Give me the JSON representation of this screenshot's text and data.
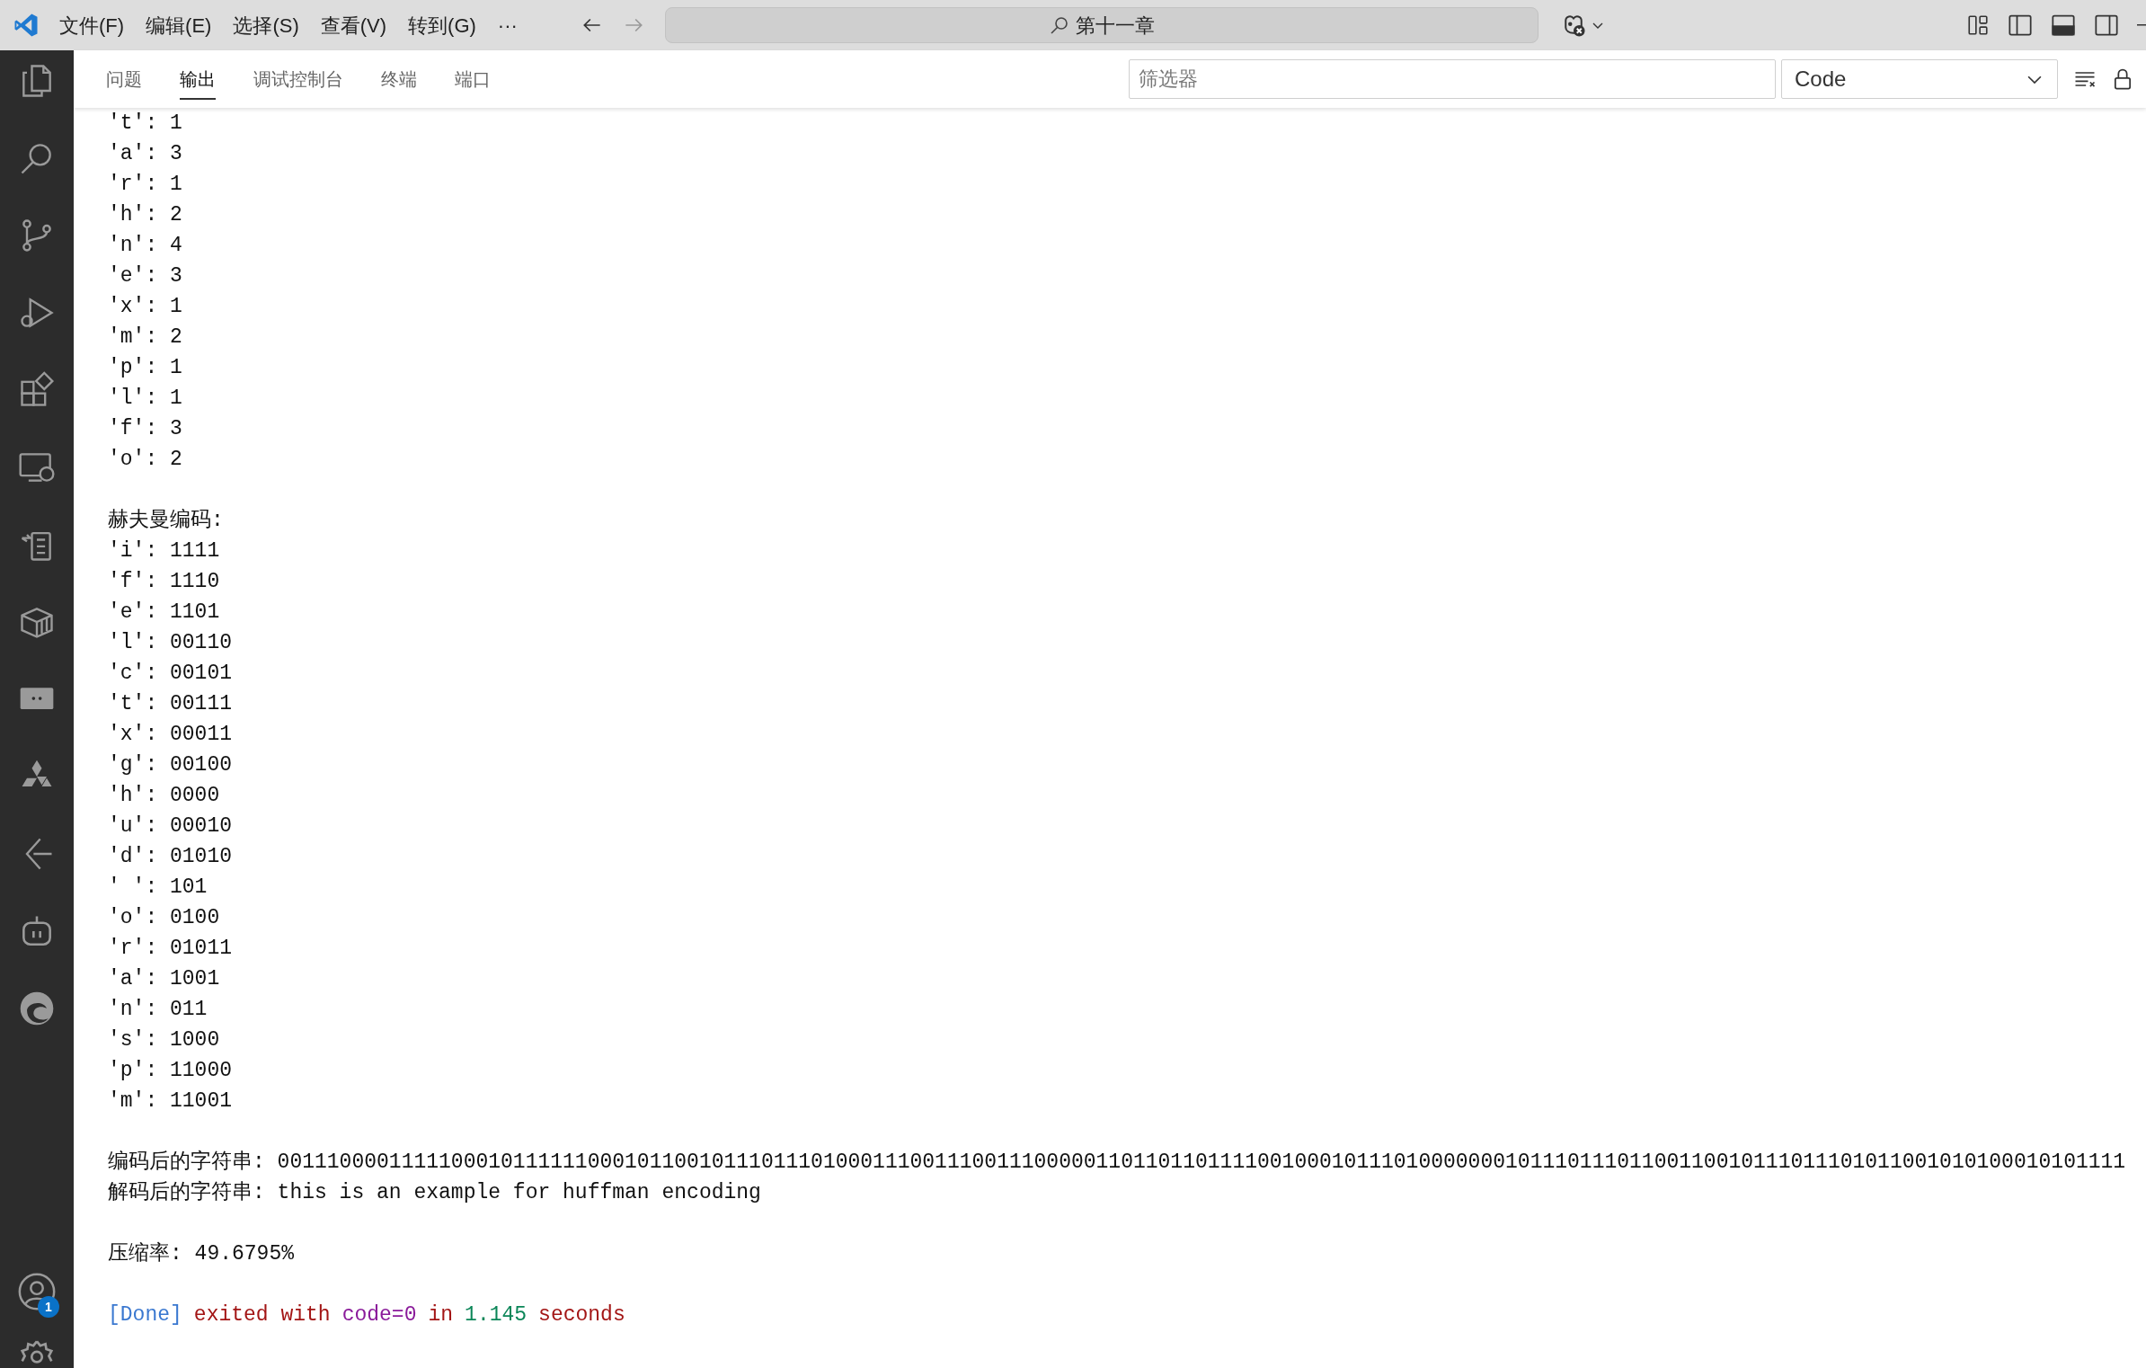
{
  "title_bar": {
    "menu": [
      "文件(F)",
      "编辑(E)",
      "选择(S)",
      "查看(V)",
      "转到(G)",
      "···"
    ],
    "search": "第十一章"
  },
  "activity_bar": {
    "account_badge": "1"
  },
  "panel": {
    "tabs": [
      {
        "label": "问题",
        "selected": false
      },
      {
        "label": "输出",
        "selected": true
      },
      {
        "label": "调试控制台",
        "selected": false
      },
      {
        "label": "终端",
        "selected": false
      },
      {
        "label": "端口",
        "selected": false
      }
    ],
    "filter": {
      "placeholder": "筛选器"
    },
    "channel": "Code"
  },
  "output": {
    "sections": [
      {
        "lines": [
          "'t': 1",
          "'a': 3",
          "'r': 1",
          "'h': 2",
          "'n': 4",
          "'e': 3",
          "'x': 1",
          "'m': 2",
          "'p': 1",
          "'l': 1",
          "'f': 3",
          "'o': 2"
        ]
      },
      {
        "lines": [
          "赫夫曼编码:",
          "'i': 1111",
          "'f': 1110",
          "'e': 1101",
          "'l': 00110",
          "'c': 00101",
          "'t': 00111",
          "'x': 00011",
          "'g': 00100",
          "'h': 0000",
          "'u': 00010",
          "'d': 01010",
          "' ': 101",
          "'o': 0100",
          "'r': 01011",
          "'a': 1001",
          "'n': 011",
          "'s': 1000",
          "'p': 11000",
          "'m': 11001"
        ]
      },
      {
        "lines": [
          "编码后的字符串: 00111000011111000101111110001011001011101110100011100111001110000011011011011110010001011101000000010111011101100110010111011101011001010100010101111",
          "解码后的字符串: this is an example for huffman encoding"
        ]
      },
      {
        "lines": [
          "压缩率: 49.6795%"
        ]
      }
    ],
    "done": [
      {
        "text": "[Done]",
        "kind": "tag"
      },
      {
        "text": "exited with",
        "kind": "keyword"
      },
      {
        "text": "code=0",
        "kind": "code"
      },
      {
        "text": "in",
        "kind": "keyword"
      },
      {
        "text": "1.145",
        "kind": "number"
      },
      {
        "text": "seconds",
        "kind": "keyword"
      }
    ]
  }
}
